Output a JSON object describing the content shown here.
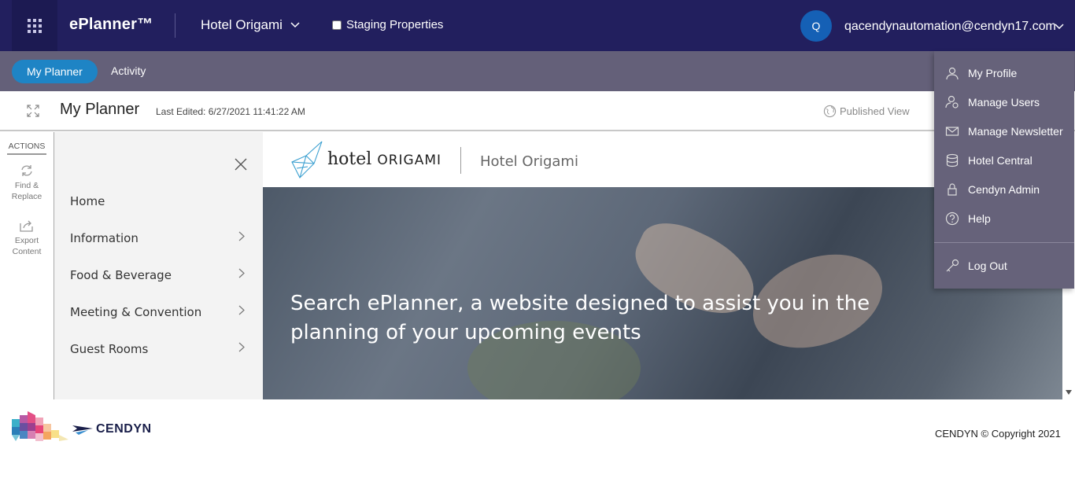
{
  "topbar": {
    "brand": "ePlanner™",
    "hotel": "Hotel Origami",
    "staging_label": "Staging Properties",
    "avatar_initial": "Q",
    "user_email": "qacendynautomation@cendyn17.com"
  },
  "subnav": {
    "active_tab": "My Planner",
    "activity": "Activity"
  },
  "titlebar": {
    "title": "My Planner",
    "last_edited": "Last Edited: 6/27/2021 11:41:22 AM",
    "published_view": "Published View"
  },
  "actions": {
    "title": "ACTIONS",
    "find_replace_1": "Find &",
    "find_replace_2": "Replace",
    "export_1": "Export",
    "export_2": "Content"
  },
  "menu": {
    "items": [
      "Home",
      "Information",
      "Food & Beverage",
      "Meeting & Convention",
      "Guest Rooms"
    ]
  },
  "site": {
    "logo_lower": "hotel",
    "logo_upper": "ORIGAMI",
    "name": "Hotel Origami",
    "hero_line1": "Search ePlanner, a website designed to assist you in the",
    "hero_line2": "planning of your upcoming events"
  },
  "footer": {
    "brand": "CENDYN",
    "copyright": "CENDYN © Copyright 2021"
  },
  "dropdown": {
    "items": [
      "My Profile",
      "Manage Users",
      "Manage Newsletter",
      "Hotel Central",
      "Cendyn Admin",
      "Help",
      "Log Out"
    ]
  },
  "colors": {
    "topbar": "#221f5e",
    "subnav": "#646079",
    "accent": "#1e84c5",
    "avatar": "#1560b5"
  }
}
